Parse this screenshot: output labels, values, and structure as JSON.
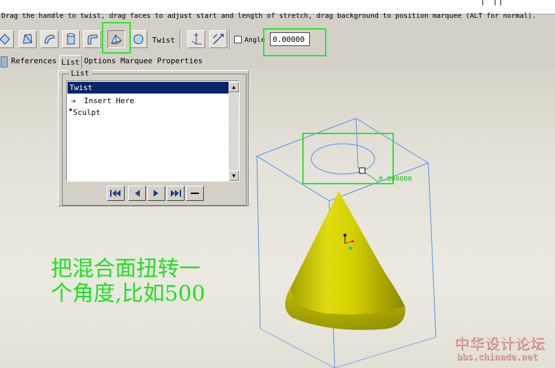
{
  "message_bar": {
    "text": "Drag the handle to twist, drag faces to adjust start and length of stretch, drag background to position marquee (ALT for normal)."
  },
  "toolbar": {
    "buttons": [
      {
        "name": "warp-transform-icon"
      },
      {
        "name": "warp-stretch-icon"
      },
      {
        "name": "warp-bend-icon"
      },
      {
        "name": "warp-cylinder-icon"
      },
      {
        "name": "warp-elbow-icon"
      },
      {
        "name": "warp-twist-icon",
        "active": true
      },
      {
        "name": "warp-sculpt-icon"
      }
    ],
    "mode_label": "Twist",
    "axis_buttons": [
      {
        "name": "axes-icon"
      },
      {
        "name": "diagonal-axis-icon"
      }
    ],
    "angle_label": "Angle",
    "angle_value": "0.00000",
    "angle_checked": false
  },
  "tabs": [
    "References",
    "List",
    "Options",
    "Marquee",
    "Properties"
  ],
  "active_tab": "List",
  "list_panel": {
    "group_title": "List",
    "header": "Twist",
    "items": [
      {
        "label": "Insert Here",
        "marker": "arrow"
      },
      {
        "label": "Sculpt",
        "marker": "square"
      }
    ],
    "nav_buttons": [
      {
        "name": "first-icon"
      },
      {
        "name": "prev-icon"
      },
      {
        "name": "next-icon"
      },
      {
        "name": "last-icon"
      },
      {
        "name": "remove-icon"
      }
    ]
  },
  "viewport": {
    "dimension_readout": "0.000000",
    "annotation_line1": "把混合面扭转一",
    "annotation_line2": "个角度,比如500",
    "watermark_line1": "中华设计论坛",
    "watermark_line2": "bbs.chinade.net"
  },
  "colors": {
    "highlight": "#28e628",
    "cone": "#e6e200",
    "marquee": "#4f8ee8",
    "selection": "#0a246a"
  }
}
